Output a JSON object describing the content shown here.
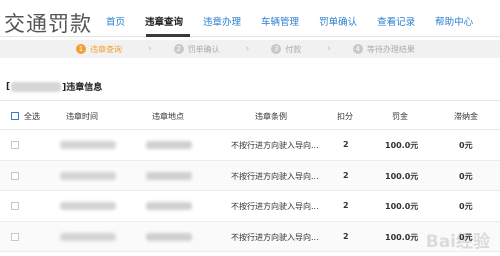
{
  "header": {
    "site_title": "交通罚款",
    "nav": [
      "首页",
      "违章查询",
      "违章办理",
      "车辆管理",
      "罚单确认",
      "查看记录",
      "帮助中心"
    ],
    "active_nav": "违章查询"
  },
  "steps": [
    {
      "num": "1",
      "label": "违章查询",
      "active": true
    },
    {
      "num": "2",
      "label": "罚单确认",
      "active": false
    },
    {
      "num": "3",
      "label": "付款",
      "active": false
    },
    {
      "num": "4",
      "label": "等待办理结果",
      "active": false
    }
  ],
  "section": {
    "prefix": "[",
    "suffix": "]违章信息"
  },
  "table": {
    "headers": [
      "全选",
      "违章时间",
      "违章地点",
      "违章条例",
      "扣分",
      "罚金",
      "滞纳金"
    ],
    "rows": [
      {
        "rule": "不按行进方向驶入导向...",
        "points": "2",
        "fine": "100.0元",
        "late_fee": "0元"
      },
      {
        "rule": "不按行进方向驶入导向...",
        "points": "2",
        "fine": "100.0元",
        "late_fee": "0元"
      },
      {
        "rule": "不按行进方向驶入导向...",
        "points": "2",
        "fine": "100.0元",
        "late_fee": "0元"
      },
      {
        "rule": "不按行进方向驶入导向...",
        "points": "2",
        "fine": "100.0元",
        "late_fee": "0元"
      }
    ]
  },
  "watermark": "Bai经验"
}
